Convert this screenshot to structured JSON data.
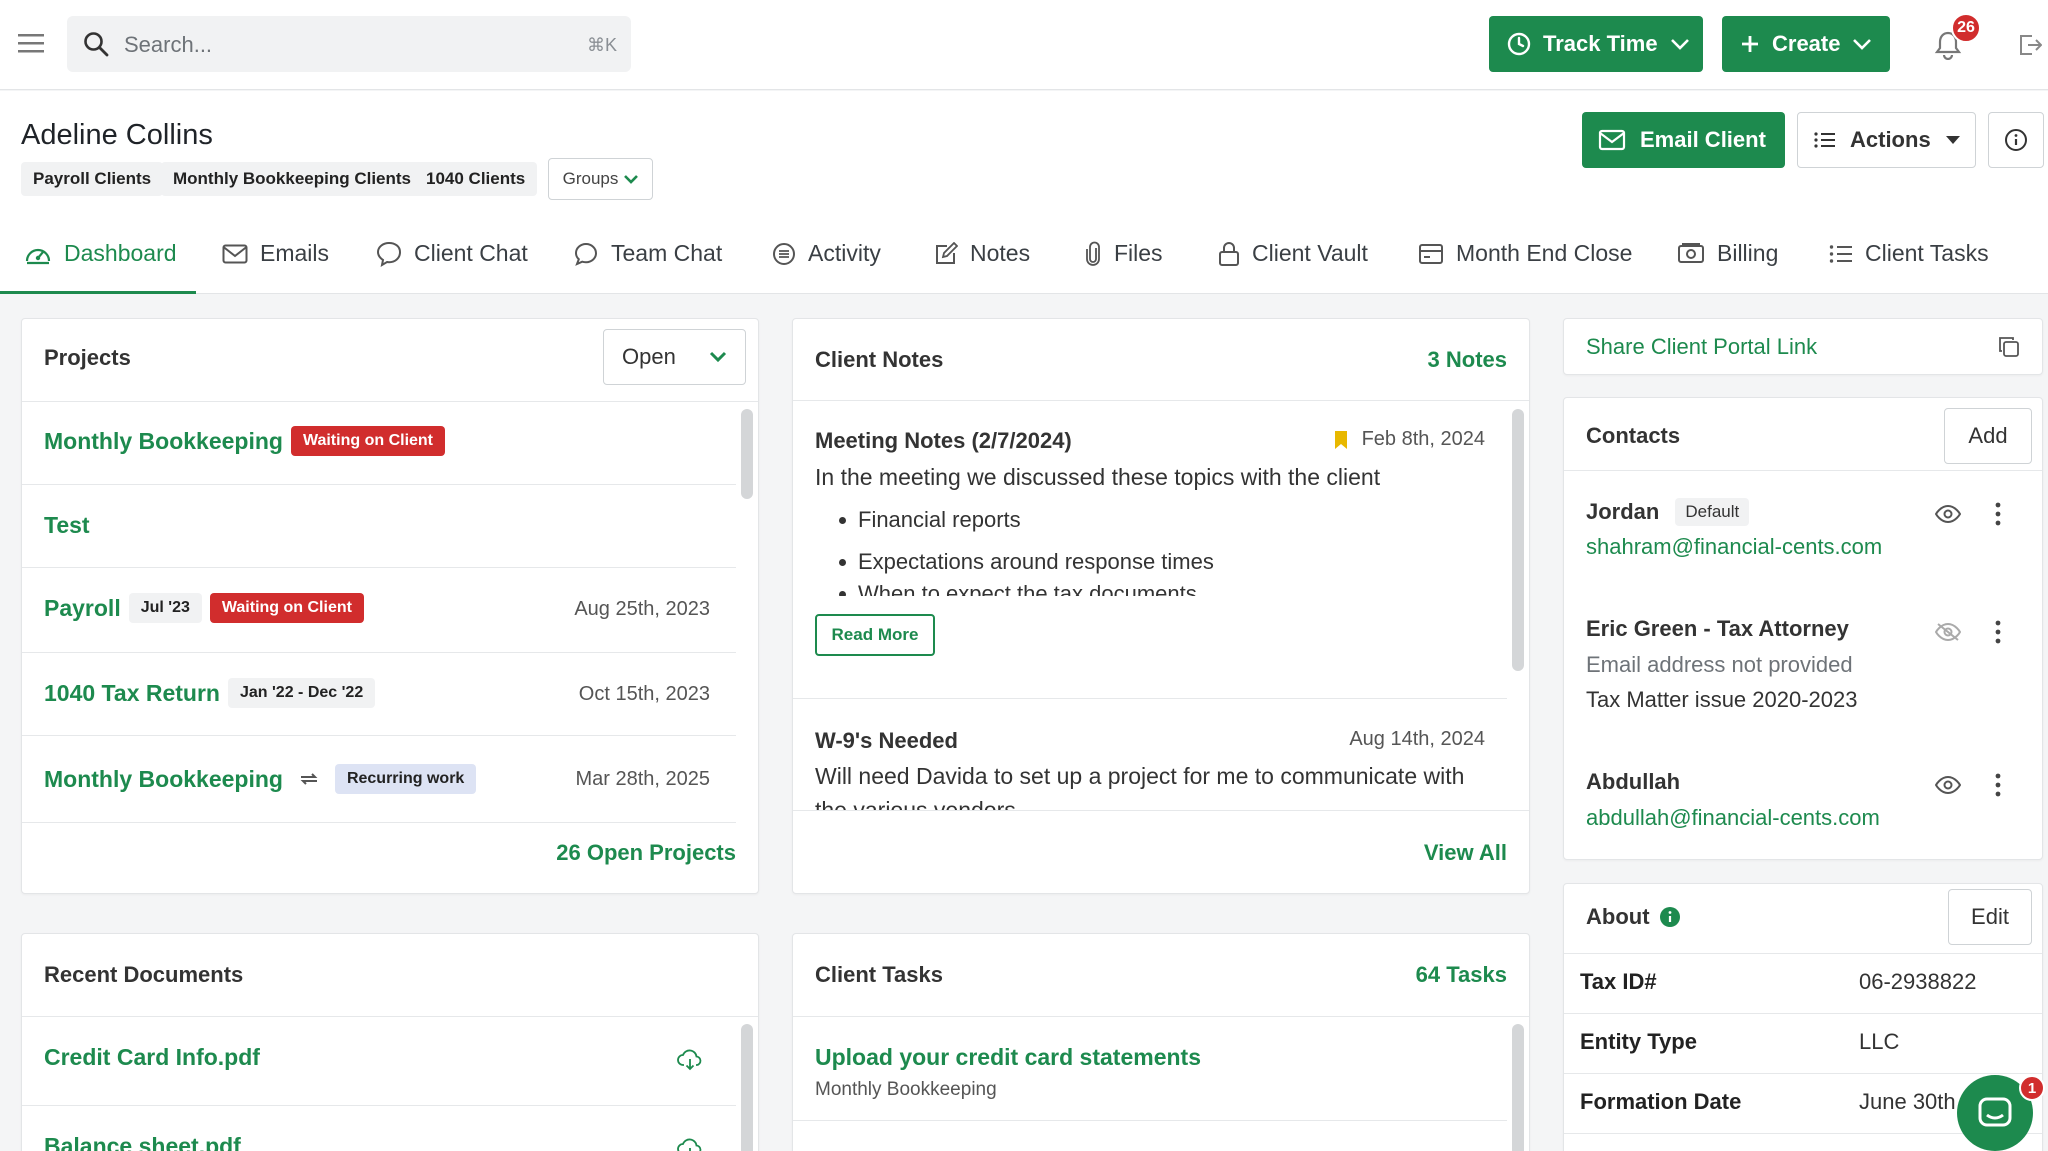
{
  "topbar": {
    "search_placeholder": "Search...",
    "search_shortcut": "⌘K",
    "track_time_label": "Track Time",
    "create_label": "Create",
    "notification_count": "26"
  },
  "client": {
    "name": "Adeline Collins",
    "tags": [
      "Payroll Clients",
      "Monthly Bookkeeping Clients",
      "1040 Clients"
    ],
    "groups_label": "Groups",
    "email_client_label": "Email Client",
    "actions_label": "Actions"
  },
  "tabs": [
    {
      "label": "Dashboard",
      "icon": "dashboard-icon"
    },
    {
      "label": "Emails",
      "icon": "mail-icon"
    },
    {
      "label": "Client Chat",
      "icon": "chat-icon"
    },
    {
      "label": "Team Chat",
      "icon": "team-chat-icon"
    },
    {
      "label": "Activity",
      "icon": "activity-icon"
    },
    {
      "label": "Notes",
      "icon": "notes-icon"
    },
    {
      "label": "Files",
      "icon": "paperclip-icon"
    },
    {
      "label": "Client Vault",
      "icon": "lock-icon"
    },
    {
      "label": "Month End Close",
      "icon": "card-icon"
    },
    {
      "label": "Billing",
      "icon": "billing-icon"
    },
    {
      "label": "Client Tasks",
      "icon": "list-icon"
    }
  ],
  "projects": {
    "title": "Projects",
    "filter_value": "Open",
    "items": [
      {
        "name": "Monthly Bookkeeping",
        "period": "",
        "status": "Waiting on Client",
        "date": ""
      },
      {
        "name": "Test",
        "period": "",
        "status": "",
        "date": ""
      },
      {
        "name": "Payroll",
        "period": "Jul '23",
        "status": "Waiting on Client",
        "date": "Aug 25th, 2023"
      },
      {
        "name": "1040 Tax Return",
        "period": "Jan '22 - Dec '22",
        "status": "",
        "date": "Oct 15th, 2023"
      },
      {
        "name": "Monthly Bookkeeping",
        "period": "",
        "status": "Recurring work",
        "date": "Mar 28th, 2025"
      }
    ],
    "footer_link": "26 Open Projects"
  },
  "client_notes": {
    "title": "Client Notes",
    "count_label": "3 Notes",
    "notes": [
      {
        "title": "Meeting Notes (2/7/2024)",
        "date": "Feb 8th, 2024",
        "body": "In the meeting we discussed these topics with the client",
        "bullets": [
          "Financial reports",
          "Expectations around response times",
          "When to expect the tax documents"
        ],
        "read_more": "Read More"
      },
      {
        "title": "W-9's Needed",
        "date": "Aug 14th, 2024",
        "body": "Will need Davida to set up a project for me to communicate with",
        "body2": "the various vendors"
      }
    ],
    "view_all": "View All"
  },
  "share_portal": {
    "label": "Share Client Portal Link"
  },
  "contacts": {
    "title": "Contacts",
    "add_label": "Add",
    "items": [
      {
        "name": "Jordan",
        "badge": "Default",
        "email": "shahram@financial-cents.com",
        "line2": ""
      },
      {
        "name": "Eric Green - Tax Attorney",
        "badge": "",
        "email": "",
        "note": "Email address not provided",
        "line2": "Tax Matter issue 2020-2023"
      },
      {
        "name": "Abdullah",
        "badge": "",
        "email": "abdullah@financial-cents.com",
        "line2": ""
      }
    ]
  },
  "recent_documents": {
    "title": "Recent Documents",
    "items": [
      "Credit Card Info.pdf",
      "Balance sheet.pdf"
    ]
  },
  "client_tasks": {
    "title": "Client Tasks",
    "count_label": "64 Tasks",
    "items": [
      {
        "title": "Upload your credit card statements",
        "project": "Monthly Bookkeeping"
      }
    ]
  },
  "about": {
    "title": "About",
    "edit_label": "Edit",
    "fields": [
      {
        "label": "Tax ID#",
        "value": "06-2938822"
      },
      {
        "label": "Entity Type",
        "value": "LLC"
      },
      {
        "label": "Formation Date",
        "value": "June 30th"
      }
    ]
  },
  "chat_widget": {
    "badge": "1"
  },
  "colors": {
    "accent": "#1d8a4e",
    "danger": "#d12d2d",
    "recurring": "#dde3f4"
  }
}
